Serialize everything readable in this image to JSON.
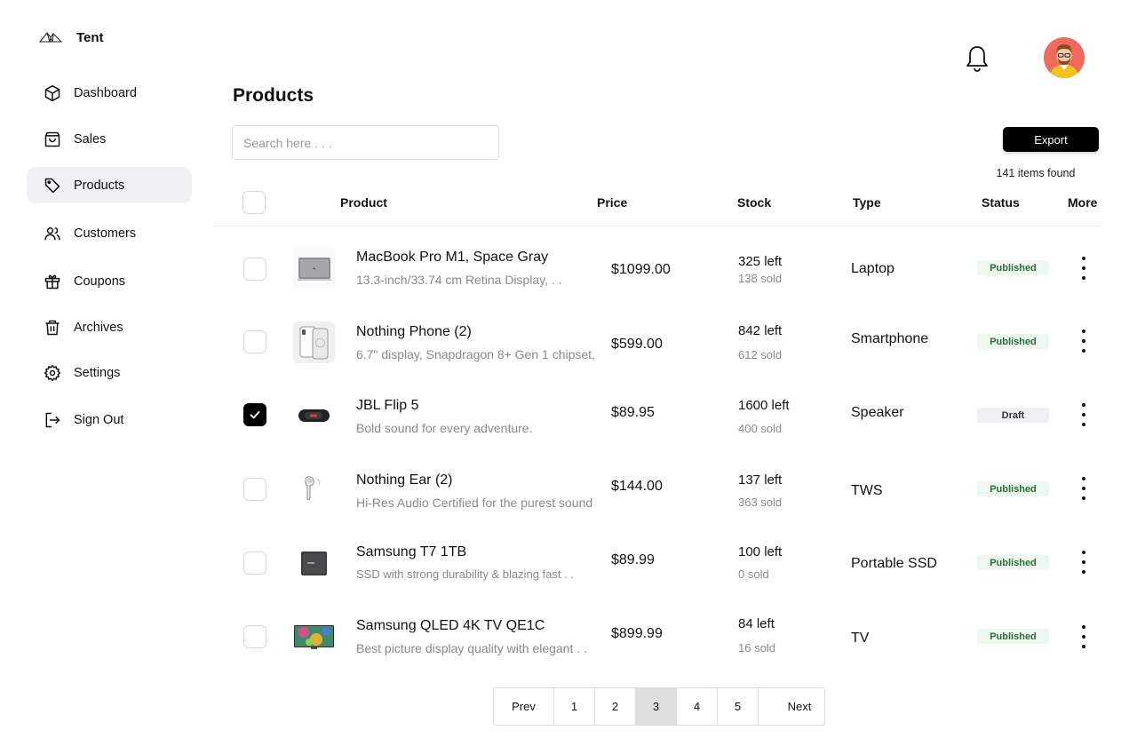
{
  "brand": {
    "name": "Tent"
  },
  "sidebar": {
    "items": [
      {
        "label": "Dashboard",
        "icon": "cube-icon"
      },
      {
        "label": "Sales",
        "icon": "shopping-bag-icon"
      },
      {
        "label": "Products",
        "icon": "tag-icon",
        "active": true
      },
      {
        "label": "Customers",
        "icon": "users-icon"
      },
      {
        "label": "Coupons",
        "icon": "gift-icon"
      },
      {
        "label": "Archives",
        "icon": "trash-icon"
      },
      {
        "label": "Settings",
        "icon": "gear-icon"
      },
      {
        "label": "Sign Out",
        "icon": "sign-out-icon"
      }
    ]
  },
  "header": {
    "title": "Products"
  },
  "search": {
    "placeholder": "Search here . . .",
    "value": ""
  },
  "toolbar": {
    "export_label": "Export",
    "items_found": "141 items found"
  },
  "table": {
    "columns": {
      "product": "Product",
      "price": "Price",
      "stock": "Stock",
      "type": "Type",
      "status": "Status",
      "more": "More"
    },
    "rows": [
      {
        "name": "MacBook Pro M1, Space Gray",
        "desc": "13.3-inch/33.74 cm Retina Display, . .",
        "price": "$1099.00",
        "left": "325 left",
        "sold": "138 sold",
        "type": "Laptop",
        "status": "Published",
        "checked": false,
        "thumb": "laptop"
      },
      {
        "name": "Nothing Phone (2)",
        "desc": "6.7\" display, Snapdragon 8+ Gen 1 chipset,",
        "price": "$599.00",
        "left": "842 left",
        "sold": "612 sold",
        "type": "Smartphone",
        "status": "Published",
        "checked": false,
        "thumb": "phone"
      },
      {
        "name": "JBL Flip 5",
        "desc": "Bold sound for every adventure.",
        "price": "$89.95",
        "left": "1600 left",
        "sold": "400 sold",
        "type": "Speaker",
        "status": "Draft",
        "checked": true,
        "thumb": "speaker"
      },
      {
        "name": "Nothing Ear (2)",
        "desc": "Hi-Res Audio Certified for the purest sound",
        "price": "$144.00",
        "left": "137 left",
        "sold": "363 sold",
        "type": "TWS",
        "status": "Published",
        "checked": false,
        "thumb": "earbud"
      },
      {
        "name": "Samsung T7 1TB",
        "desc": "SSD with strong durability & blazing fast . .",
        "price": "$89.99",
        "left": "100 left",
        "sold": "0 sold",
        "type": "Portable SSD",
        "status": "Published",
        "checked": false,
        "thumb": "ssd"
      },
      {
        "name": "Samsung QLED 4K TV QE1C",
        "desc": "Best picture display quality with elegant . .",
        "price": "$899.99",
        "left": "84 left",
        "sold": "16 sold",
        "type": "TV",
        "status": "Published",
        "checked": false,
        "thumb": "tv"
      }
    ]
  },
  "pagination": {
    "prev": "Prev",
    "next": "Next",
    "pages": [
      "1",
      "2",
      "3",
      "4",
      "5"
    ],
    "current": "3"
  }
}
